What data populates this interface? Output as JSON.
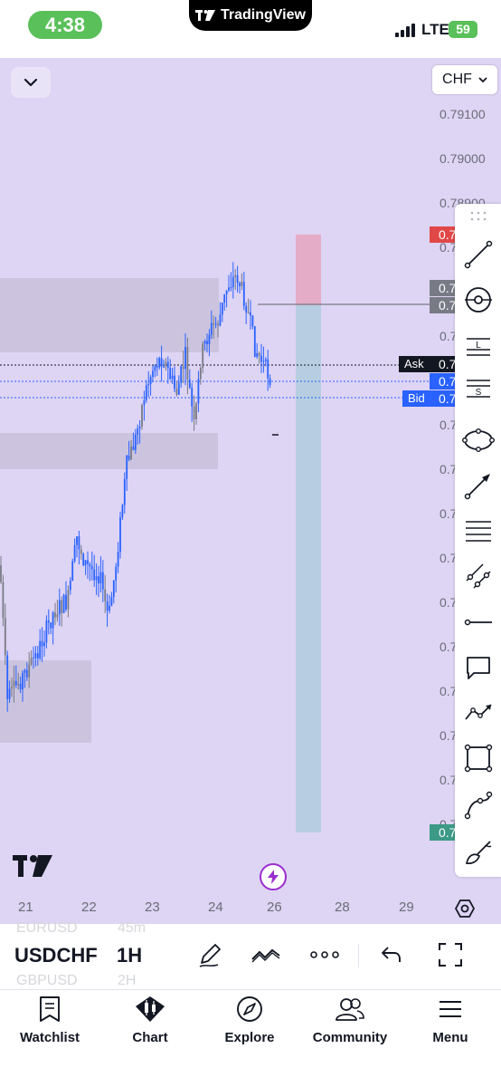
{
  "status": {
    "time": "4:38",
    "network": "LTE",
    "battery": "59"
  },
  "app": {
    "name": "TradingView"
  },
  "chart": {
    "currency": "CHF",
    "price_ticks": [
      "0.79100",
      "0.79000",
      "0.78900",
      "0.7",
      "0.7",
      "0.7",
      "0.7",
      "0.7",
      "0.7",
      "0.7",
      "0.7",
      "0.7",
      "0.7",
      "0.7",
      "0.7",
      "0.7",
      "0.7"
    ],
    "price_tags": {
      "top_red": "0.7",
      "gray_1": "0.7",
      "gray_2": "0.7",
      "ask": "0.7",
      "mid": "0.7",
      "bid": "0.7",
      "green": "0.7"
    },
    "ask_label": "Ask",
    "bid_label": "Bid",
    "date_ticks": [
      "21",
      "22",
      "23",
      "24",
      "26",
      "28",
      "29"
    ],
    "colors": {
      "background": "#ded4f4",
      "candle": "#2962ff",
      "candle_old": "#787b86",
      "target_zone": "#e5a4bd",
      "stop_zone": "#b3cde0",
      "ask_line": "#131722",
      "bid_line": "#2962ff",
      "tag_red": "#e04848",
      "tag_gray": "#787b86",
      "tag_blue": "#2962ff",
      "tag_green": "#3c9a86"
    }
  },
  "toolbar": {
    "tools": [
      "trend-line",
      "circle-target",
      "long-position",
      "short-position",
      "ellipse",
      "arrow",
      "horizontal-lines",
      "parallel-channel",
      "horizontal-ray",
      "comment",
      "path",
      "rectangle",
      "curve",
      "brush"
    ]
  },
  "symbol_bar": {
    "prev_symbol": "EURUSD",
    "prev_interval": "45m",
    "symbol": "USDCHF",
    "interval": "1H",
    "next_symbol": "GBPUSD",
    "next_interval": "2H"
  },
  "nav": {
    "items": [
      {
        "label": "Watchlist",
        "icon": "watchlist-icon"
      },
      {
        "label": "Chart",
        "icon": "chart-icon"
      },
      {
        "label": "Explore",
        "icon": "compass-icon"
      },
      {
        "label": "Community",
        "icon": "community-icon"
      },
      {
        "label": "Menu",
        "icon": "menu-icon"
      }
    ]
  }
}
